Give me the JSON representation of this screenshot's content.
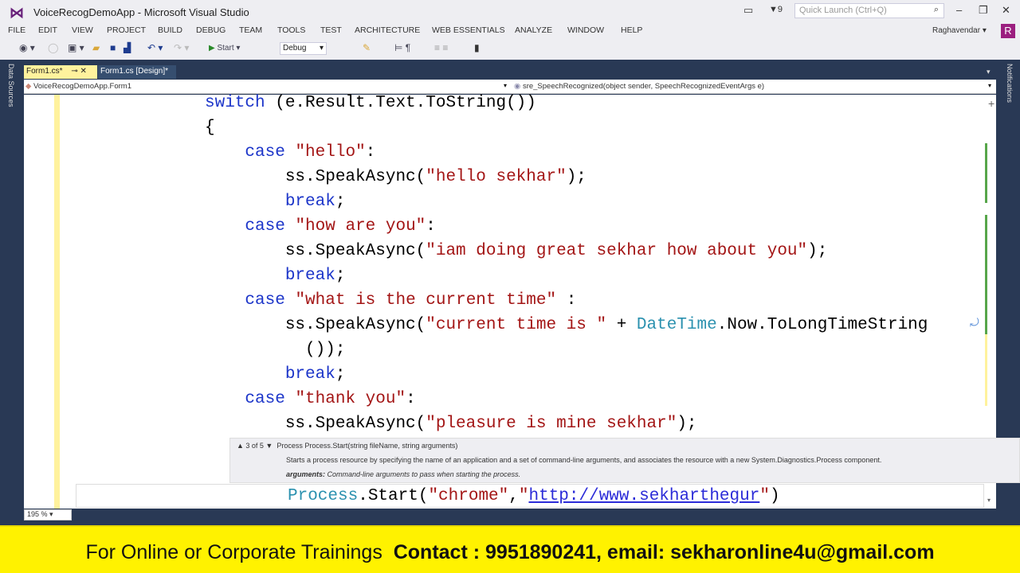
{
  "window": {
    "title": "VoiceRecogDemoApp - Microsoft Visual Studio",
    "quick_launch_placeholder": "Quick Launch (Ctrl+Q)",
    "notification_count": "9",
    "user": "Raghavendar",
    "avatar_letter": "R"
  },
  "menu": [
    "FILE",
    "EDIT",
    "VIEW",
    "PROJECT",
    "BUILD",
    "DEBUG",
    "TEAM",
    "TOOLS",
    "TEST",
    "ARCHITECTURE",
    "WEB ESSENTIALS",
    "ANALYZE",
    "WINDOW",
    "HELP"
  ],
  "toolbar": {
    "start_label": "Start",
    "config": "Debug"
  },
  "side": {
    "left": "Data Sources",
    "right": "Notifications"
  },
  "tabs": [
    {
      "label": "Form1.cs*"
    },
    {
      "label": "Form1.cs [Design]*"
    }
  ],
  "nav": {
    "class": "VoiceRecogDemoApp.Form1",
    "member": "sre_SpeechRecognized(object sender, SpeechRecognizedEventArgs e)"
  },
  "code": [
    [
      {
        "t": "switch",
        "c": "kw"
      },
      {
        "t": " (e.Result.Text.ToString())"
      }
    ],
    [
      {
        "t": "{"
      }
    ],
    [
      {
        "t": "    "
      },
      {
        "t": "case",
        "c": "kw"
      },
      {
        "t": " "
      },
      {
        "t": "\"hello\"",
        "c": "str"
      },
      {
        "t": ":"
      }
    ],
    [
      {
        "t": "        ss.SpeakAsync("
      },
      {
        "t": "\"hello sekhar\"",
        "c": "str"
      },
      {
        "t": ");"
      }
    ],
    [
      {
        "t": "        "
      },
      {
        "t": "break",
        "c": "kw"
      },
      {
        "t": ";"
      }
    ],
    [
      {
        "t": "    "
      },
      {
        "t": "case",
        "c": "kw"
      },
      {
        "t": " "
      },
      {
        "t": "\"how are you\"",
        "c": "str"
      },
      {
        "t": ":"
      }
    ],
    [
      {
        "t": "        ss.SpeakAsync("
      },
      {
        "t": "\"iam doing great sekhar how about you\"",
        "c": "str"
      },
      {
        "t": ");"
      }
    ],
    [
      {
        "t": "        "
      },
      {
        "t": "break",
        "c": "kw"
      },
      {
        "t": ";"
      }
    ],
    [
      {
        "t": "    "
      },
      {
        "t": "case",
        "c": "kw"
      },
      {
        "t": " "
      },
      {
        "t": "\"what is the current time\"",
        "c": "str"
      },
      {
        "t": " :"
      }
    ],
    [
      {
        "t": "        ss.SpeakAsync("
      },
      {
        "t": "\"current time is \"",
        "c": "str"
      },
      {
        "t": " + "
      },
      {
        "t": "DateTime",
        "c": "ty"
      },
      {
        "t": ".Now.ToLongTimeString"
      }
    ],
    [
      {
        "t": "          ());"
      }
    ],
    [
      {
        "t": "        "
      },
      {
        "t": "break",
        "c": "kw"
      },
      {
        "t": ";"
      }
    ],
    [
      {
        "t": "    "
      },
      {
        "t": "case",
        "c": "kw"
      },
      {
        "t": " "
      },
      {
        "t": "\"thank you\"",
        "c": "str"
      },
      {
        "t": ":"
      }
    ],
    [
      {
        "t": "        ss.SpeakAsync("
      },
      {
        "t": "\"pleasure is mine sekhar\"",
        "c": "str"
      },
      {
        "t": ");"
      }
    ]
  ],
  "current_line": [
    {
      "t": "Process",
      "c": "ty"
    },
    {
      "t": ".Start("
    },
    {
      "t": "\"chrome\"",
      "c": "str"
    },
    {
      "t": ","
    },
    {
      "t": "\"",
      "c": "str"
    },
    {
      "t": "http://www.sekharthegur",
      "c": "url"
    },
    {
      "t": "\"",
      "c": "str"
    },
    {
      "t": ")"
    }
  ],
  "tooltip": {
    "counter": "▲ 3 of 5 ▼",
    "signature": "Process Process.Start(string fileName, string arguments)",
    "description": "Starts a process resource by specifying the name of an application and a set of command-line arguments, and associates the resource with a new System.Diagnostics.Process component.",
    "arg_name": "arguments:",
    "arg_desc": "Command-line arguments to pass when starting the process."
  },
  "zoom": "195 %",
  "banner": {
    "left": "For Online or Corporate Trainings",
    "contact": "Contact : 9951890241, email: sekharonline4u@gmail.com"
  }
}
